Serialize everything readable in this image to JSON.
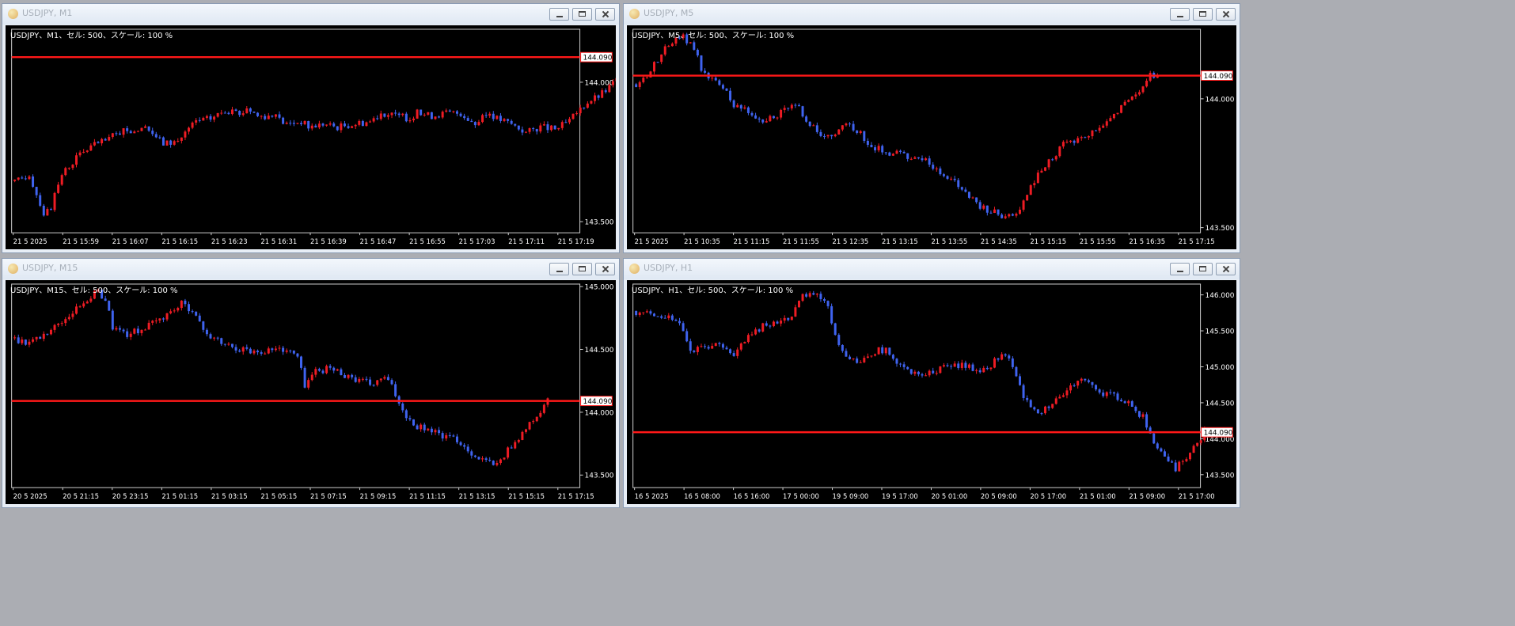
{
  "colors": {
    "bull": "#ee1c24",
    "bear": "#3f63ef",
    "line": "#ff1818",
    "grid": "#cfcfcf",
    "text": "#ffffff",
    "price_box_bg": "#ffffff"
  },
  "icons": {
    "app": "mt-app-icon",
    "minimize": "minimize-icon",
    "restore": "restore-icon",
    "close": "close-icon"
  },
  "windows": [
    {
      "title": "USDJPY, M1",
      "active": false,
      "info": "USDJPY、M1、セル: 500、スケール: 100 %",
      "chart_data": {
        "type": "candlestick",
        "symbol": "USDJPY",
        "timeframe": "M1",
        "line_price": 144.09,
        "line_label": "144.090",
        "ylim": [
          143.46,
          144.19
        ],
        "yticks": [
          {
            "v": 144.0,
            "label": "144.000"
          },
          {
            "v": 143.5,
            "label": "143.500"
          }
        ],
        "xlabels": [
          "21 5 2025",
          "21 5 15:59",
          "21 5 16:07",
          "21 5 16:15",
          "21 5 16:23",
          "21 5 16:31",
          "21 5 16:39",
          "21 5 16:47",
          "21 5 16:55",
          "21 5 17:03",
          "21 5 17:11",
          "21 5 17:19"
        ],
        "candles_n": 123,
        "closes": [
          [
            0,
            143.64
          ],
          [
            4,
            143.67
          ],
          [
            8,
            143.53
          ],
          [
            10,
            143.55
          ],
          [
            13,
            143.67
          ],
          [
            17,
            143.73
          ],
          [
            21,
            143.77
          ],
          [
            25,
            143.79
          ],
          [
            29,
            143.82
          ],
          [
            33,
            143.83
          ],
          [
            37,
            143.83
          ],
          [
            41,
            143.78
          ],
          [
            45,
            143.79
          ],
          [
            47,
            143.82
          ],
          [
            50,
            143.86
          ],
          [
            54,
            143.87
          ],
          [
            58,
            143.9
          ],
          [
            62,
            143.88
          ],
          [
            64,
            143.91
          ],
          [
            67,
            143.88
          ],
          [
            71,
            143.88
          ],
          [
            75,
            143.85
          ],
          [
            79,
            143.86
          ],
          [
            81,
            143.84
          ],
          [
            85,
            143.85
          ],
          [
            89,
            143.84
          ],
          [
            93,
            143.85
          ],
          [
            98,
            143.86
          ],
          [
            101,
            143.89
          ],
          [
            105,
            143.88
          ],
          [
            109,
            143.87
          ],
          [
            111,
            143.89
          ],
          [
            115,
            143.88
          ],
          [
            119,
            143.89
          ],
          [
            123,
            143.89
          ],
          [
            127,
            143.85
          ],
          [
            131,
            143.89
          ],
          [
            133,
            143.87
          ],
          [
            137,
            143.85
          ],
          [
            141,
            143.82
          ],
          [
            145,
            143.84
          ],
          [
            149,
            143.83
          ],
          [
            153,
            143.86
          ],
          [
            155,
            143.89
          ],
          [
            158,
            143.93
          ],
          [
            161,
            143.95
          ],
          [
            163,
            143.97
          ],
          [
            166,
            144.01
          ],
          [
            169,
            144.02
          ],
          [
            172,
            144.04
          ],
          [
            175,
            144.08
          ],
          [
            178,
            144.09
          ],
          [
            180,
            144.08
          ]
        ]
      }
    },
    {
      "title": "USDJPY, M5",
      "active": false,
      "info": "USDJPY、M5、セル: 500、スケール: 100 %",
      "chart_data": {
        "type": "candlestick",
        "symbol": "USDJPY",
        "timeframe": "M5",
        "line_price": 144.09,
        "line_label": "144.090",
        "ylim": [
          143.48,
          144.27
        ],
        "yticks": [
          {
            "v": 144.0,
            "label": "144.000"
          },
          {
            "v": 143.5,
            "label": "143.500"
          }
        ],
        "xlabels": [
          "21 5 2025",
          "21 5 10:35",
          "21 5 11:15",
          "21 5 11:55",
          "21 5 12:35",
          "21 5 13:15",
          "21 5 13:55",
          "21 5 14:35",
          "21 5 15:15",
          "21 5 15:55",
          "21 5 16:35",
          "21 5 17:15"
        ],
        "candles_n": 123,
        "closes": [
          [
            0,
            144.05
          ],
          [
            4,
            144.11
          ],
          [
            7,
            144.18
          ],
          [
            10,
            144.22
          ],
          [
            13,
            144.24
          ],
          [
            16,
            144.2
          ],
          [
            18,
            144.12
          ],
          [
            21,
            144.07
          ],
          [
            24,
            144.04
          ],
          [
            27,
            143.98
          ],
          [
            31,
            143.95
          ],
          [
            35,
            143.92
          ],
          [
            39,
            143.94
          ],
          [
            42,
            143.97
          ],
          [
            45,
            143.96
          ],
          [
            48,
            143.9
          ],
          [
            51,
            143.85
          ],
          [
            54,
            143.86
          ],
          [
            57,
            143.9
          ],
          [
            61,
            143.88
          ],
          [
            65,
            143.82
          ],
          [
            69,
            143.79
          ],
          [
            72,
            143.79
          ],
          [
            75,
            143.78
          ],
          [
            78,
            143.77
          ],
          [
            82,
            143.74
          ],
          [
            85,
            143.71
          ],
          [
            89,
            143.66
          ],
          [
            92,
            143.62
          ],
          [
            95,
            143.58
          ],
          [
            98,
            143.56
          ],
          [
            101,
            143.55
          ],
          [
            104,
            143.55
          ],
          [
            107,
            143.6
          ],
          [
            110,
            143.68
          ],
          [
            114,
            143.76
          ],
          [
            118,
            143.82
          ],
          [
            122,
            143.84
          ],
          [
            126,
            143.87
          ],
          [
            130,
            143.91
          ],
          [
            133,
            143.95
          ],
          [
            137,
            144.0
          ],
          [
            140,
            144.05
          ],
          [
            142,
            144.09
          ],
          [
            144,
            144.1
          ]
        ]
      }
    },
    {
      "title": "USDJPY, M15",
      "active": false,
      "info": "USDJPY、M15、セル: 500、スケール: 100 %",
      "chart_data": {
        "type": "candlestick",
        "symbol": "USDJPY",
        "timeframe": "M15",
        "line_price": 144.09,
        "line_label": "144.090",
        "ylim": [
          143.4,
          145.02
        ],
        "yticks": [
          {
            "v": 145.0,
            "label": "145.000"
          },
          {
            "v": 144.5,
            "label": "144.500"
          },
          {
            "v": 144.0,
            "label": "144.000"
          },
          {
            "v": 143.5,
            "label": "143.500"
          }
        ],
        "xlabels": [
          "20 5 2025",
          "20 5 21:15",
          "20 5 23:15",
          "21 5 01:15",
          "21 5 03:15",
          "21 5 05:15",
          "21 5 07:15",
          "21 5 09:15",
          "21 5 11:15",
          "21 5 13:15",
          "21 5 15:15",
          "21 5 17:15"
        ],
        "candles_n": 123,
        "closes": [
          [
            0,
            144.58
          ],
          [
            4,
            144.56
          ],
          [
            7,
            144.6
          ],
          [
            10,
            144.66
          ],
          [
            13,
            144.72
          ],
          [
            16,
            144.8
          ],
          [
            20,
            144.9
          ],
          [
            23,
            144.96
          ],
          [
            25,
            144.9
          ],
          [
            27,
            144.68
          ],
          [
            31,
            144.62
          ],
          [
            35,
            144.66
          ],
          [
            39,
            144.72
          ],
          [
            43,
            144.8
          ],
          [
            46,
            144.86
          ],
          [
            49,
            144.82
          ],
          [
            51,
            144.7
          ],
          [
            54,
            144.6
          ],
          [
            57,
            144.55
          ],
          [
            60,
            144.52
          ],
          [
            63,
            144.5
          ],
          [
            67,
            144.48
          ],
          [
            71,
            144.5
          ],
          [
            75,
            144.5
          ],
          [
            78,
            144.44
          ],
          [
            80,
            144.22
          ],
          [
            83,
            144.33
          ],
          [
            87,
            144.35
          ],
          [
            91,
            144.3
          ],
          [
            95,
            144.25
          ],
          [
            99,
            144.22
          ],
          [
            102,
            144.28
          ],
          [
            104,
            144.2
          ],
          [
            107,
            144.02
          ],
          [
            110,
            143.9
          ],
          [
            114,
            143.87
          ],
          [
            118,
            143.81
          ],
          [
            122,
            143.78
          ],
          [
            125,
            143.7
          ],
          [
            128,
            143.63
          ],
          [
            131,
            143.6
          ],
          [
            133,
            143.58
          ],
          [
            136,
            143.7
          ],
          [
            139,
            143.8
          ],
          [
            142,
            143.9
          ],
          [
            145,
            144.0
          ],
          [
            147,
            144.1
          ]
        ]
      }
    },
    {
      "title": "USDJPY, H1",
      "active": false,
      "info": "USDJPY、H1、セル: 500、スケール: 100 %",
      "chart_data": {
        "type": "candlestick",
        "symbol": "USDJPY",
        "timeframe": "H1",
        "line_price": 144.09,
        "line_label": "144.090",
        "ylim": [
          143.32,
          146.15
        ],
        "yticks": [
          {
            "v": 146.0,
            "label": "146.000"
          },
          {
            "v": 145.5,
            "label": "145.500"
          },
          {
            "v": 145.0,
            "label": "145.000"
          },
          {
            "v": 144.5,
            "label": "144.500"
          },
          {
            "v": 144.0,
            "label": "144.000"
          },
          {
            "v": 143.5,
            "label": "143.500"
          }
        ],
        "xlabels": [
          "16 5 2025",
          "16 5 08:00",
          "16 5 16:00",
          "17 5 00:00",
          "19 5 09:00",
          "19 5 17:00",
          "20 5 01:00",
          "20 5 09:00",
          "20 5 17:00",
          "21 5 01:00",
          "21 5 09:00",
          "21 5 17:00"
        ],
        "candles_n": 123,
        "closes": [
          [
            0,
            145.75
          ],
          [
            4,
            145.72
          ],
          [
            8,
            145.7
          ],
          [
            12,
            145.6
          ],
          [
            15,
            145.2
          ],
          [
            19,
            145.3
          ],
          [
            23,
            145.28
          ],
          [
            27,
            145.18
          ],
          [
            31,
            145.4
          ],
          [
            35,
            145.58
          ],
          [
            39,
            145.62
          ],
          [
            43,
            145.72
          ],
          [
            46,
            145.98
          ],
          [
            49,
            146.02
          ],
          [
            52,
            145.96
          ],
          [
            56,
            145.3
          ],
          [
            59,
            145.1
          ],
          [
            62,
            145.08
          ],
          [
            65,
            145.2
          ],
          [
            69,
            145.25
          ],
          [
            72,
            145.05
          ],
          [
            75,
            144.95
          ],
          [
            78,
            144.88
          ],
          [
            82,
            144.95
          ],
          [
            86,
            145.0
          ],
          [
            90,
            145.02
          ],
          [
            94,
            144.95
          ],
          [
            97,
            144.95
          ],
          [
            101,
            145.2
          ],
          [
            104,
            145.0
          ],
          [
            107,
            144.6
          ],
          [
            110,
            144.4
          ],
          [
            113,
            144.4
          ],
          [
            116,
            144.55
          ],
          [
            119,
            144.65
          ],
          [
            122,
            144.8
          ],
          [
            125,
            144.8
          ],
          [
            128,
            144.65
          ],
          [
            131,
            144.6
          ],
          [
            134,
            144.55
          ],
          [
            137,
            144.45
          ],
          [
            140,
            144.3
          ],
          [
            143,
            143.9
          ],
          [
            146,
            143.75
          ],
          [
            149,
            143.58
          ],
          [
            151,
            143.7
          ],
          [
            153,
            143.82
          ],
          [
            155,
            143.95
          ],
          [
            157,
            144.1
          ]
        ]
      }
    }
  ]
}
